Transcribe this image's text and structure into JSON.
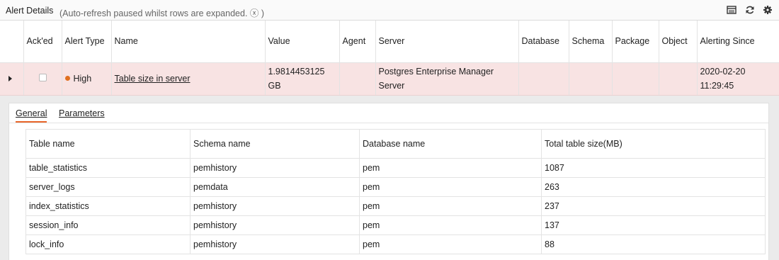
{
  "titlebar": {
    "title": "Alert Details",
    "subtitle": "(Auto-refresh paused whilst rows are expanded. ⓧ )",
    "icons": [
      "table-view-icon",
      "refresh-icon",
      "settings-gear-icon"
    ]
  },
  "alert_table": {
    "columns": {
      "acked": "Ack'ed",
      "alert_type": "Alert Type",
      "name": "Name",
      "value": "Value",
      "agent": "Agent",
      "server": "Server",
      "database": "Database",
      "schema": "Schema",
      "package": "Package",
      "object": "Object",
      "alerting_since": "Alerting Since"
    },
    "row": {
      "acked": false,
      "alert_type": "High",
      "alert_color": "#e07020",
      "name": "Table size in server",
      "value": "1.9814453125 GB",
      "agent": "",
      "server": "Postgres Enterprise Manager Server",
      "database": "",
      "schema": "",
      "package": "",
      "object": "",
      "alerting_since": "2020-02-20 11:29:45"
    },
    "row_bg": "#f8e3e3"
  },
  "detail": {
    "tabs": {
      "general": "General",
      "parameters": "Parameters"
    },
    "active_tab": "general",
    "accent": "#e8662a",
    "table": {
      "headers": {
        "table_name": "Table name",
        "schema_name": "Schema name",
        "database_name": "Database name",
        "total_size": "Total table size(MB)"
      },
      "rows": [
        {
          "table_name": "table_statistics",
          "schema_name": "pemhistory",
          "database_name": "pem",
          "total_size": "1087"
        },
        {
          "table_name": "server_logs",
          "schema_name": "pemdata",
          "database_name": "pem",
          "total_size": "263"
        },
        {
          "table_name": "index_statistics",
          "schema_name": "pemhistory",
          "database_name": "pem",
          "total_size": "237"
        },
        {
          "table_name": "session_info",
          "schema_name": "pemhistory",
          "database_name": "pem",
          "total_size": "137"
        },
        {
          "table_name": "lock_info",
          "schema_name": "pemhistory",
          "database_name": "pem",
          "total_size": "88"
        }
      ]
    }
  }
}
